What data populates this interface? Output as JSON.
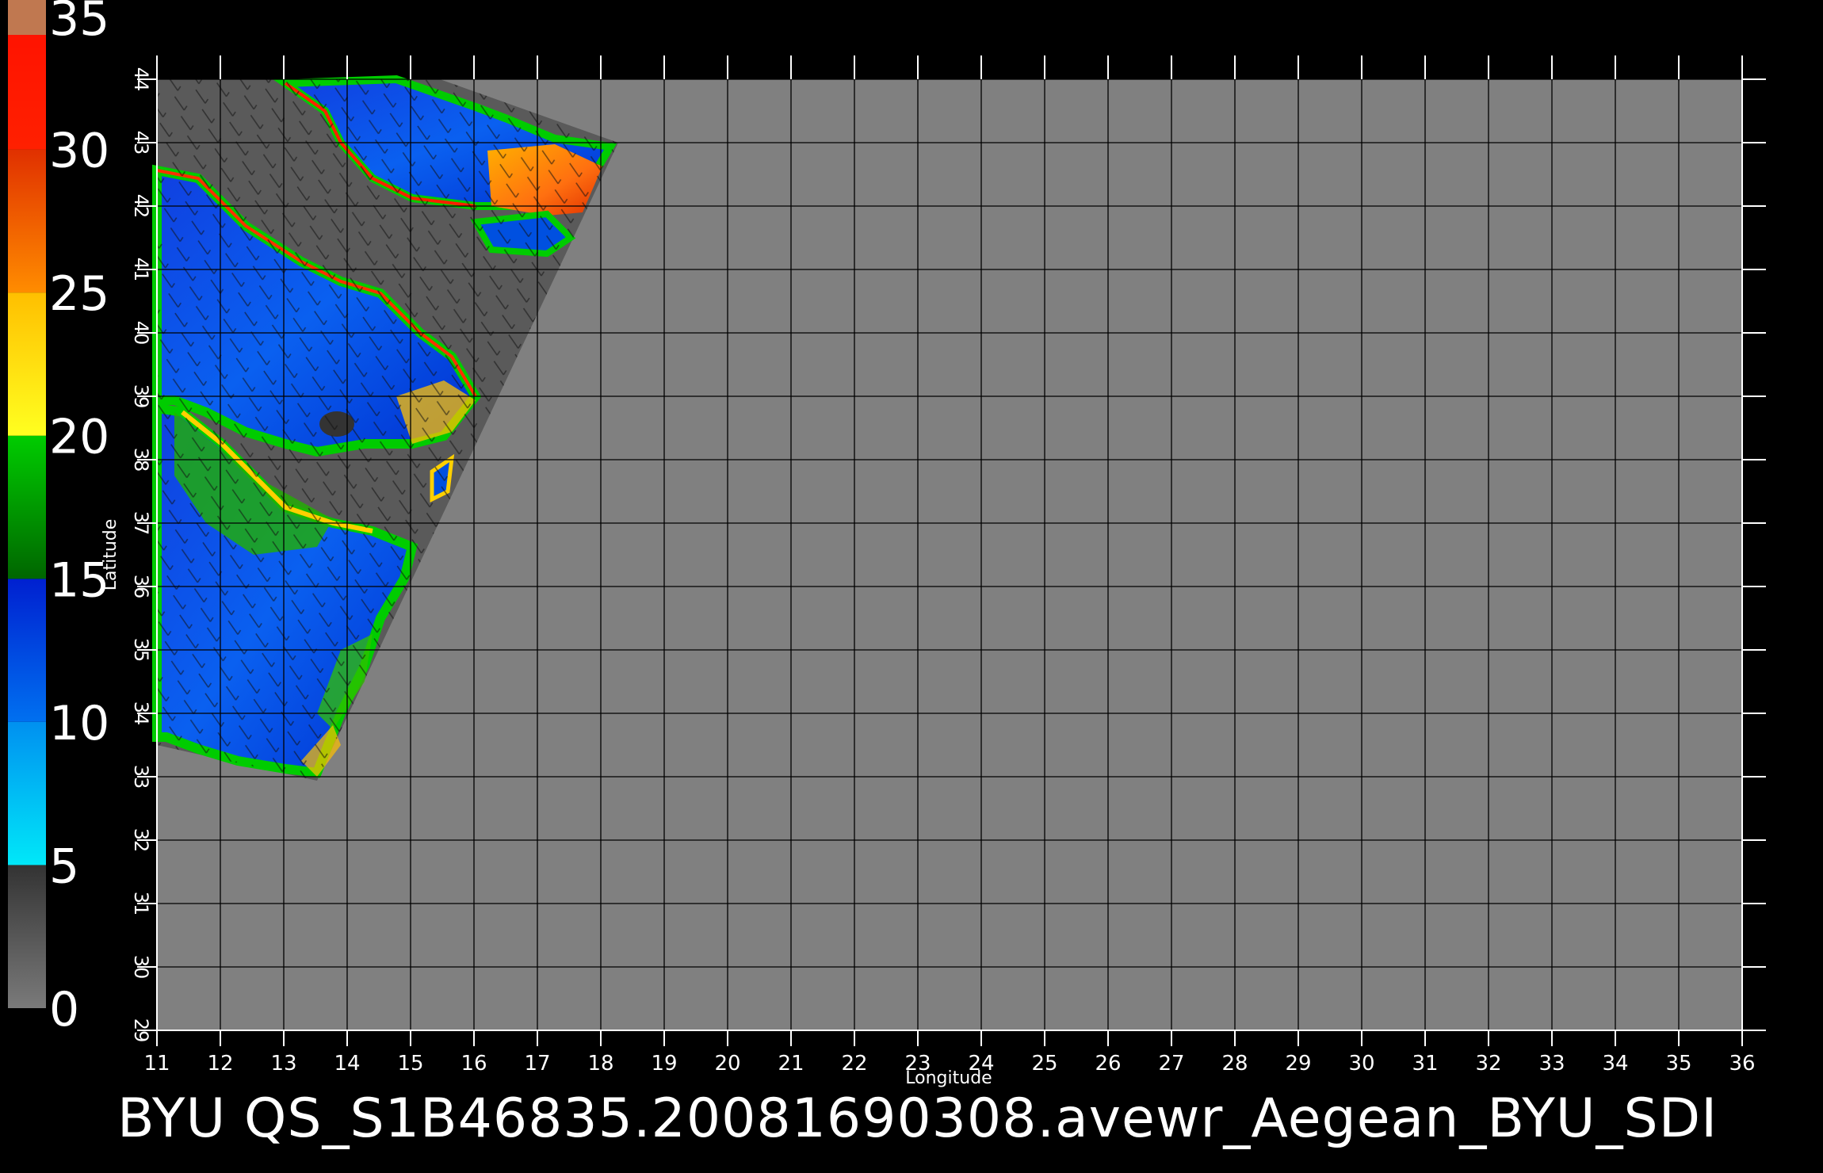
{
  "title": "BYU  QS_S1B46835.20081690308.avewr_Aegean_BYU_SDI",
  "axes": {
    "xlabel": "Longitude",
    "ylabel": "Latitude",
    "lon_range": [
      11,
      36
    ],
    "lat_range": [
      29,
      44
    ],
    "lon_ticks": [
      "11",
      "12",
      "13",
      "14",
      "15",
      "16",
      "17",
      "18",
      "19",
      "20",
      "21",
      "22",
      "23",
      "24",
      "25",
      "26",
      "27",
      "28",
      "29",
      "30",
      "31",
      "32",
      "33",
      "34",
      "35",
      "36"
    ],
    "lat_ticks": [
      "29",
      "30",
      "31",
      "32",
      "33",
      "34",
      "35",
      "36",
      "37",
      "38",
      "39",
      "40",
      "41",
      "42",
      "43",
      "44"
    ],
    "grid": true
  },
  "colorbar": {
    "labels": [
      "0",
      "5",
      "10",
      "15",
      "20",
      "25",
      "30",
      "35"
    ],
    "range": [
      0,
      35
    ],
    "stops": [
      {
        "from": 0,
        "to": 5,
        "colors": [
          "#7a7a7a",
          "#333333"
        ]
      },
      {
        "from": 5,
        "to": 10,
        "colors": [
          "#00e8f8",
          "#0090f0"
        ]
      },
      {
        "from": 10,
        "to": 15,
        "colors": [
          "#0070f0",
          "#0020d0"
        ]
      },
      {
        "from": 15,
        "to": 20,
        "colors": [
          "#006600",
          "#00cc00"
        ]
      },
      {
        "from": 20,
        "to": 25,
        "colors": [
          "#ffff20",
          "#ffbf00"
        ]
      },
      {
        "from": 25,
        "to": 30,
        "colors": [
          "#ff8c00",
          "#e03000"
        ]
      },
      {
        "from": 30,
        "to": 35,
        "colors": [
          "#ff2000",
          "#ff1000"
        ]
      }
    ],
    "top_color": "#c07850"
  },
  "colors": {
    "background": "#000000",
    "land": "#808080",
    "no_data": "#5a5a5a",
    "grid": "#000000",
    "text": "#ffffff"
  }
}
